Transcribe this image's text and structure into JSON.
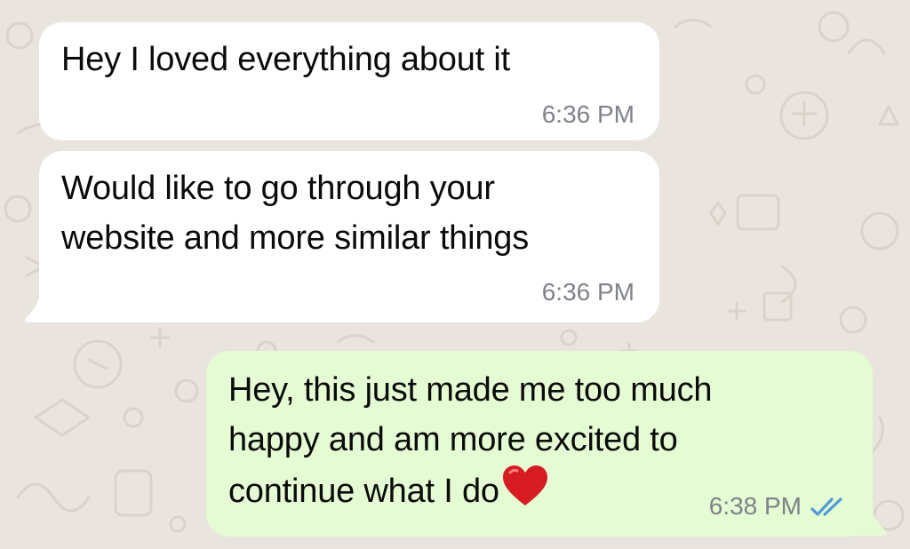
{
  "chat": {
    "background_color": "#e9e4dd",
    "incoming_bubble_color": "#ffffff",
    "outgoing_bubble_color": "#e4fbd3",
    "tick_color": "#4f9bd9",
    "messages": [
      {
        "direction": "incoming",
        "text": "Hey I loved everything about it",
        "time": "6:36 PM"
      },
      {
        "direction": "incoming",
        "text": "Would like to go through your\nwebsite and more similar things",
        "time": "6:36 PM"
      },
      {
        "direction": "outgoing",
        "text": "Hey, this just made me too much\nhappy and am more excited to\ncontinue what I do",
        "emoji": "red-heart",
        "time": "6:38 PM",
        "status": "read"
      }
    ]
  }
}
